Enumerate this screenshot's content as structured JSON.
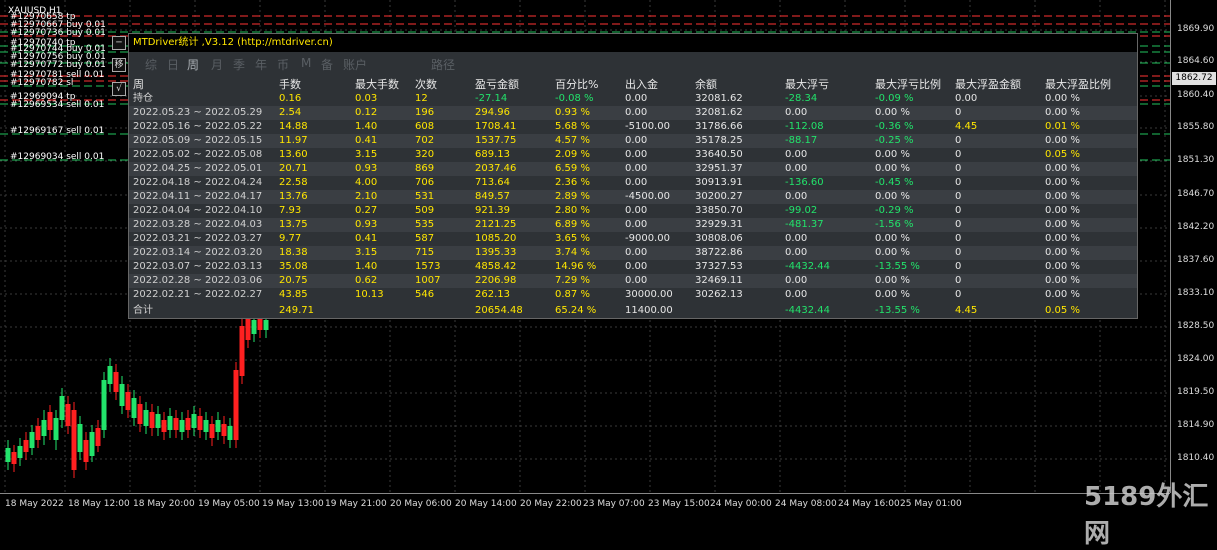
{
  "symbol": "XAUUSD,H1",
  "orders": [
    "#12970658 tp",
    "#12970667 buy 0.01",
    "#12970736 buy 0.01",
    "#12970740 tp",
    "#12970744 buy 0.01",
    "#12970756 buy 0.01",
    "#12970772 buy 0.01",
    "#12970781 sell 0.01",
    "#12970782 sl",
    "#12969094 tp",
    "#12969534 sell 0.01",
    "#12969167 sell 0.01",
    "#12969034 sell 0.01"
  ],
  "price_axis": [
    "1869.90",
    "1864.60",
    "1860.40",
    "1855.80",
    "1851.30",
    "1846.70",
    "1842.20",
    "1837.60",
    "1833.10",
    "1828.50",
    "1824.00",
    "1819.50",
    "1814.90",
    "1810.40"
  ],
  "current_price": "1862.72",
  "time_axis": [
    "18 May 2022",
    "18 May 12:00",
    "18 May 20:00",
    "19 May 05:00",
    "19 May 13:00",
    "19 May 21:00",
    "20 May 06:00",
    "20 May 14:00",
    "20 May 22:00",
    "23 May 07:00",
    "23 May 15:00",
    "24 May 00:00",
    "24 May 08:00",
    "24 May 16:00",
    "25 May 01:00"
  ],
  "watermark": "5189外汇网",
  "side_buttons": [
    "─",
    "移",
    "√"
  ],
  "panel": {
    "title": "MTDriver统计 ,V3.12 (http://mtdriver.cn)",
    "tabs": [
      "综",
      "日",
      "周",
      "月",
      "季",
      "年",
      "币",
      "M",
      "备",
      "账户",
      "路径"
    ],
    "active_tab": "周",
    "headers": [
      "周",
      "手数",
      "最大手数",
      "次数",
      "盈亏金额",
      "百分比%",
      "出入金",
      "余额",
      "最大浮亏",
      "最大浮亏比例",
      "最大浮盈金额",
      "最大浮盈比例"
    ],
    "holding": [
      "持仓",
      "0.16",
      "0.03",
      "12",
      "-27.14",
      "-0.08 %",
      "0.00",
      "32081.62",
      "-28.34",
      "-0.09 %",
      "0.00",
      "0.00 %"
    ],
    "rows": [
      [
        "2022.05.23 ~ 2022.05.29",
        "2.54",
        "0.12",
        "196",
        "294.96",
        "0.93 %",
        "0.00",
        "32081.62",
        "0.00",
        "0.00 %",
        "0",
        "0.00 %"
      ],
      [
        "2022.05.16 ~ 2022.05.22",
        "14.88",
        "1.40",
        "608",
        "1708.41",
        "5.68 %",
        "-5100.00",
        "31786.66",
        "-112.08",
        "-0.36 %",
        "4.45",
        "0.01 %"
      ],
      [
        "2022.05.09 ~ 2022.05.15",
        "11.97",
        "0.41",
        "702",
        "1537.75",
        "4.57 %",
        "0.00",
        "35178.25",
        "-88.17",
        "-0.25 %",
        "0",
        "0.00 %"
      ],
      [
        "2022.05.02 ~ 2022.05.08",
        "13.60",
        "3.15",
        "320",
        "689.13",
        "2.09 %",
        "0.00",
        "33640.50",
        "0.00",
        "0.00 %",
        "0",
        "0.05 %"
      ],
      [
        "2022.04.25 ~ 2022.05.01",
        "20.71",
        "0.93",
        "869",
        "2037.46",
        "6.59 %",
        "0.00",
        "32951.37",
        "0.00",
        "0.00 %",
        "0",
        "0.00 %"
      ],
      [
        "2022.04.18 ~ 2022.04.24",
        "22.58",
        "4.00",
        "706",
        "713.64",
        "2.36 %",
        "0.00",
        "30913.91",
        "-136.60",
        "-0.45 %",
        "0",
        "0.00 %"
      ],
      [
        "2022.04.11 ~ 2022.04.17",
        "13.76",
        "2.10",
        "531",
        "849.57",
        "2.89 %",
        "-4500.00",
        "30200.27",
        "0.00",
        "0.00 %",
        "0",
        "0.00 %"
      ],
      [
        "2022.04.04 ~ 2022.04.10",
        "7.93",
        "0.27",
        "509",
        "921.39",
        "2.80 %",
        "0.00",
        "33850.70",
        "-99.02",
        "-0.29 %",
        "0",
        "0.00 %"
      ],
      [
        "2022.03.28 ~ 2022.04.03",
        "13.75",
        "0.93",
        "535",
        "2121.25",
        "6.89 %",
        "0.00",
        "32929.31",
        "-481.37",
        "-1.56 %",
        "0",
        "0.00 %"
      ],
      [
        "2022.03.21 ~ 2022.03.27",
        "9.77",
        "0.41",
        "587",
        "1085.20",
        "3.65 %",
        "-9000.00",
        "30808.06",
        "0.00",
        "0.00 %",
        "0",
        "0.00 %"
      ],
      [
        "2022.03.14 ~ 2022.03.20",
        "18.38",
        "3.15",
        "715",
        "1395.33",
        "3.74 %",
        "0.00",
        "38722.86",
        "0.00",
        "0.00 %",
        "0",
        "0.00 %"
      ],
      [
        "2022.03.07 ~ 2022.03.13",
        "35.08",
        "1.40",
        "1573",
        "4858.42",
        "14.96 %",
        "0.00",
        "37327.53",
        "-4432.44",
        "-13.55 %",
        "0",
        "0.00 %"
      ],
      [
        "2022.02.28 ~ 2022.03.06",
        "20.75",
        "0.62",
        "1007",
        "2206.98",
        "7.29 %",
        "0.00",
        "32469.11",
        "0.00",
        "0.00 %",
        "0",
        "0.00 %"
      ],
      [
        "2022.02.21 ~ 2022.02.27",
        "43.85",
        "10.13",
        "546",
        "262.13",
        "0.87 %",
        "30000.00",
        "30262.13",
        "0.00",
        "0.00 %",
        "0",
        "0.00 %"
      ]
    ],
    "total": [
      "合计",
      "249.71",
      "",
      "",
      "20654.48",
      "65.24 %",
      "11400.00",
      "",
      "-4432.44",
      "-13.55 %",
      "4.45",
      "0.05 %"
    ],
    "colors": {
      "positive": "#ffe600",
      "negative": "#22e36b",
      "neutral": "#e6e6e6"
    }
  }
}
